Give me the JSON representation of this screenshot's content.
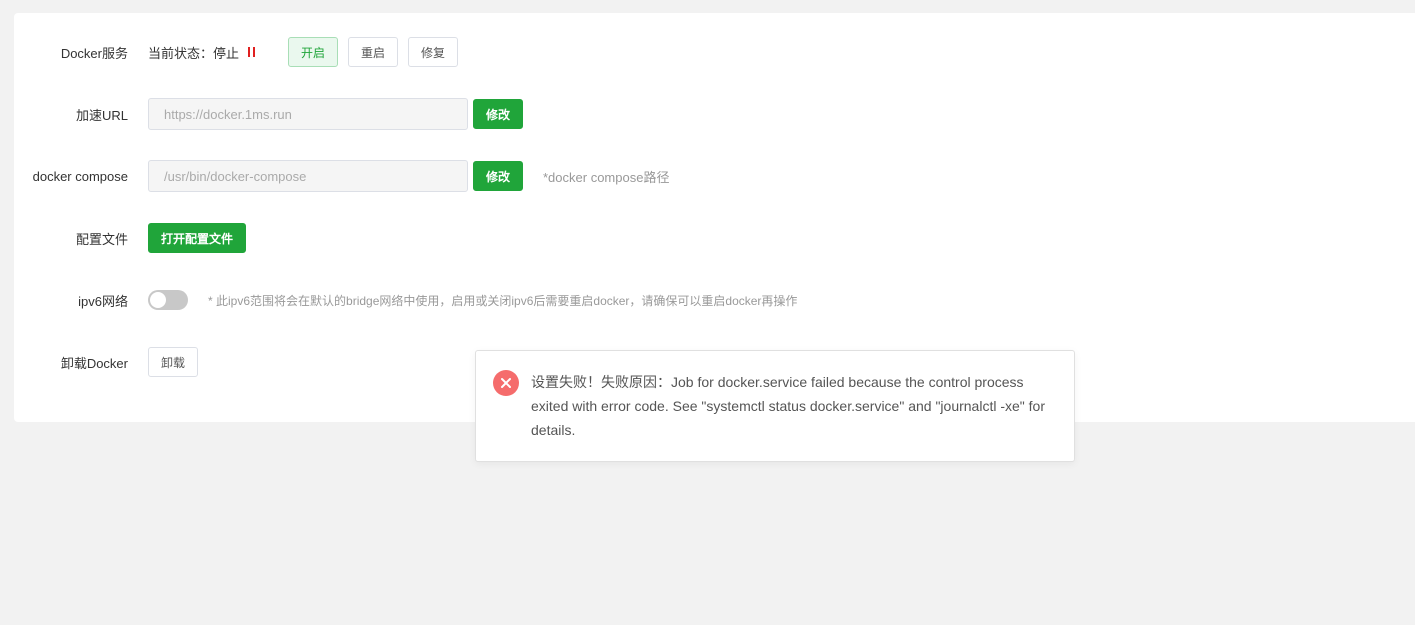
{
  "service": {
    "label": "Docker服务",
    "status_text": "当前状态：停止",
    "status_icon": "pause-icon",
    "status_color": "#e02020",
    "start_label": "开启",
    "restart_label": "重启",
    "repair_label": "修复"
  },
  "mirror": {
    "label": "加速URL",
    "value": "https://docker.1ms.run",
    "modify_label": "修改"
  },
  "compose": {
    "label": "docker compose",
    "value": "/usr/bin/docker-compose",
    "modify_label": "修改",
    "hint": "*docker compose路径"
  },
  "config": {
    "label": "配置文件",
    "open_label": "打开配置文件"
  },
  "ipv6": {
    "label": "ipv6网络",
    "enabled": false,
    "hint": "* 此ipv6范围将会在默认的bridge网络中使用，启用或关闭ipv6后需要重启docker，请确保可以重启docker再操作"
  },
  "uninstall": {
    "label": "卸载Docker",
    "button_label": "卸载"
  },
  "toast": {
    "icon": "close-icon",
    "color": "#f56c6c",
    "message": "设置失败！失败原因：Job for docker.service failed because the control process exited with error code. See \"systemctl status docker.service\" and \"journalctl -xe\" for details."
  },
  "colors": {
    "accent": "#20a53a",
    "background": "#f2f2f2"
  }
}
